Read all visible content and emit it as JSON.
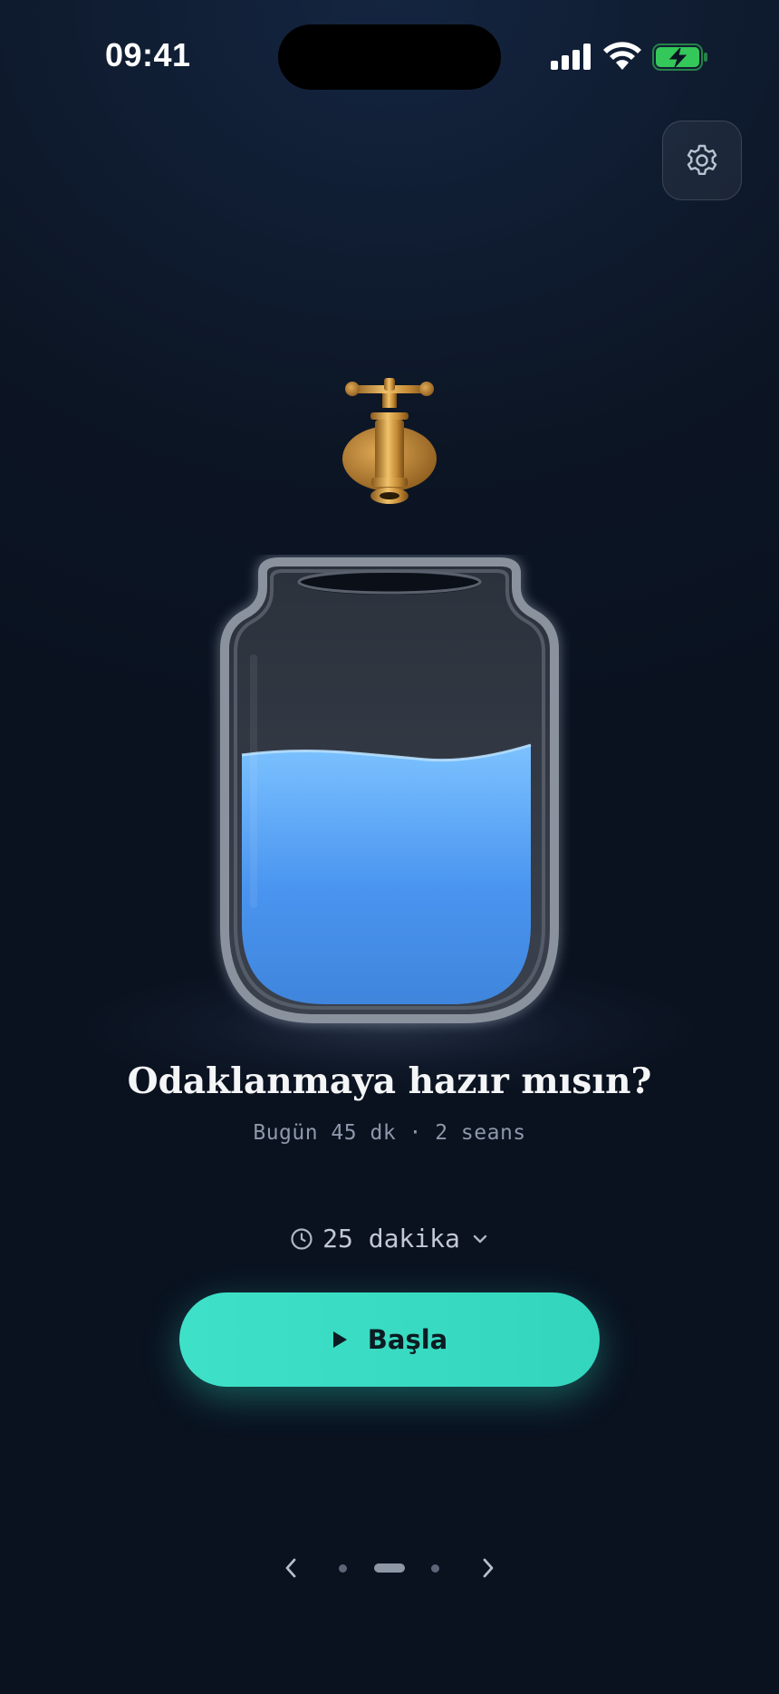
{
  "status_bar": {
    "time": "09:41",
    "icons": [
      "cellular-signal-icon",
      "wifi-icon",
      "battery-charging-icon"
    ],
    "battery_color": "#34c759"
  },
  "header": {
    "settings_icon": "gear-icon"
  },
  "illustration": {
    "tap_icon": "brass-faucet",
    "jar_fill_fraction": 0.57,
    "water_color": "#5aa2f0"
  },
  "main": {
    "title": "Odaklanmaya hazır mısın?",
    "stats": "Bugün 45 dk · 2 seans"
  },
  "duration_selector": {
    "value": "25 dakika",
    "icon": "clock-icon",
    "chevron": "chevron-down-icon"
  },
  "start_button": {
    "label": "Başla",
    "icon": "play-icon",
    "color": "#3ddcc4"
  },
  "pager": {
    "count": 3,
    "active_index": 1,
    "prev_icon": "chevron-left-icon",
    "next_icon": "chevron-right-icon"
  }
}
